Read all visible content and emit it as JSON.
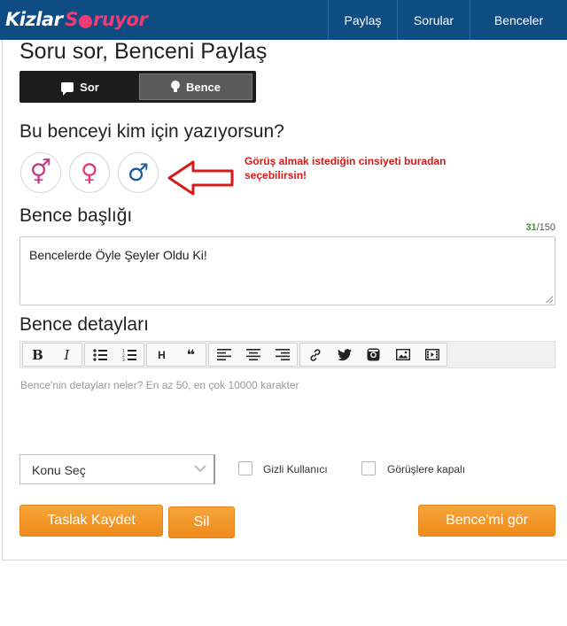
{
  "header": {
    "logo": {
      "part1": "Kizlar",
      "part2": "S",
      "part3": "ruyor"
    },
    "nav": [
      "Paylaş",
      "Sorular",
      "Benceler"
    ]
  },
  "page": {
    "title": "Soru sor, Benceni Paylaş",
    "toggle": {
      "sor": "Sor",
      "bence": "Bence",
      "active": "Bence"
    }
  },
  "audience": {
    "heading": "Bu benceyi kim için yazıyorsun?",
    "options": [
      {
        "name": "both",
        "symbol_f": "⚥"
      },
      {
        "name": "female",
        "symbol": "♀"
      },
      {
        "name": "male",
        "symbol": "♂"
      }
    ],
    "hint_line1": "Görüş almak istediğin cinsiyeti buradan",
    "hint_line2": "seçebilirsin!"
  },
  "title_field": {
    "heading": "Bence başlığı",
    "counter_current": "31",
    "counter_max": "/150",
    "value": "Bencelerde Öyle Şeyler Oldu Ki!"
  },
  "details": {
    "heading": "Bence detayları",
    "toolbar": {
      "bold": "B",
      "italic": "I",
      "heading": "H",
      "quote": "❝"
    },
    "placeholder": "Bence'nin detayları neler? En az 50, en çok 10000 karakter"
  },
  "options": {
    "topic_select": "Konu Seç",
    "anonymous_label": "Gizli Kullanıcı",
    "comments_closed_label": "Görüşlere kapalı"
  },
  "actions": {
    "draft": "Taslak Kaydet",
    "delete": "Sil",
    "preview": "Bence'mi gör"
  },
  "colors": {
    "nav_bg": "#0f4c84",
    "accent_orange": "#f29a2a",
    "hint_red": "#d51a1a",
    "female_pink": "#d93d80",
    "male_blue": "#1d5c99"
  }
}
